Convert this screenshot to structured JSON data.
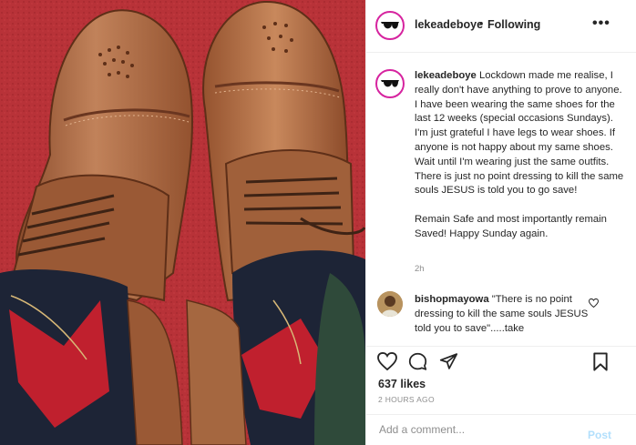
{
  "post": {
    "username": "lekeadeboye",
    "separator": "•",
    "follow_status": "Following",
    "more_label": "•••",
    "caption": "Lockdown made me realise, I really don't have anything to prove to anyone. I have been wearing the same shoes for the last 12 weeks (special occasions Sundays). I'm just grateful I have legs to wear shoes. If anyone is not happy about my same shoes. Wait until I'm wearing just the same outfits. There is just no point dressing to kill the same souls JESUS is told you to go save!\n\nRemain Safe and most importantly remain Saved! Happy Sunday again.",
    "caption_time": "2h",
    "likes": "637 likes",
    "posted": "2 HOURS AGO"
  },
  "comment": {
    "username": "bishopmayowa",
    "text": "\"There is no point dressing to kill the same souls JESUS told you to save\".....take"
  },
  "add_comment": {
    "placeholder": "Add a comment...",
    "post_label": "Post"
  },
  "icons": {
    "avatar": "sunglasses-emoji-icon",
    "more": "more-options-icon",
    "comment_like": "heart-icon",
    "like": "heart-icon",
    "comment": "comment-icon",
    "share": "share-icon",
    "save": "bookmark-icon"
  },
  "colors": {
    "carpet": "#b83238",
    "shoe": "#b06d46",
    "story_ring": "#d6249f",
    "post_button": "#b2dffc",
    "secondary_text": "#8e8e8e"
  }
}
